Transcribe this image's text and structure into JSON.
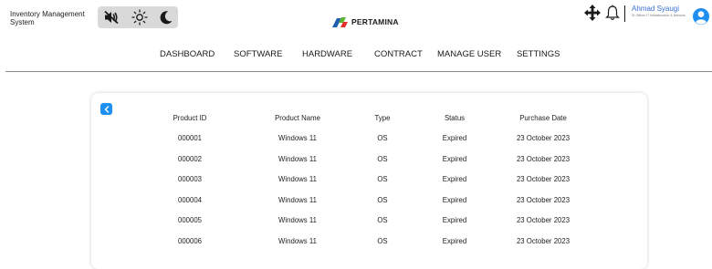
{
  "app": {
    "title_line1": "Inventory Management",
    "title_line2": "System"
  },
  "mode_icons": [
    "volume-mute-icon",
    "sun-icon",
    "moon-icon"
  ],
  "brand": {
    "name": "PERTAMINA",
    "colors": {
      "blue": "#1f5fae",
      "green": "#5cb531",
      "red": "#e52b2d"
    }
  },
  "user": {
    "name": "Ahmad Syaugi",
    "role": "Sr Officer IT Infrastructure & Network"
  },
  "nav": {
    "items": [
      {
        "label": "DASHBOARD"
      },
      {
        "label": "SOFTWARE"
      },
      {
        "label": "HARDWARE"
      },
      {
        "label": "CONTRACT"
      },
      {
        "label": "MANAGE USER"
      },
      {
        "label": "SETTINGS"
      }
    ]
  },
  "table": {
    "headers": [
      "Product ID",
      "Product Name",
      "Type",
      "Status",
      "Purchase Date"
    ],
    "rows": [
      [
        "000001",
        "Windows 11",
        "OS",
        "Expired",
        "23 October 2023"
      ],
      [
        "000002",
        "Windows 11",
        "OS",
        "Expired",
        "23 October 2023"
      ],
      [
        "000003",
        "Windows 11",
        "OS",
        "Expired",
        "23 October 2023"
      ],
      [
        "000004",
        "Windows 11",
        "OS",
        "Expired",
        "23 October 2023"
      ],
      [
        "000005",
        "Windows 11",
        "OS",
        "Expired",
        "23 October 2023"
      ],
      [
        "000006",
        "Windows 11",
        "OS",
        "Expired",
        "23 October 2023"
      ]
    ]
  },
  "colors": {
    "accent": "#1f8ff2",
    "user_name": "#3a6fd0"
  }
}
